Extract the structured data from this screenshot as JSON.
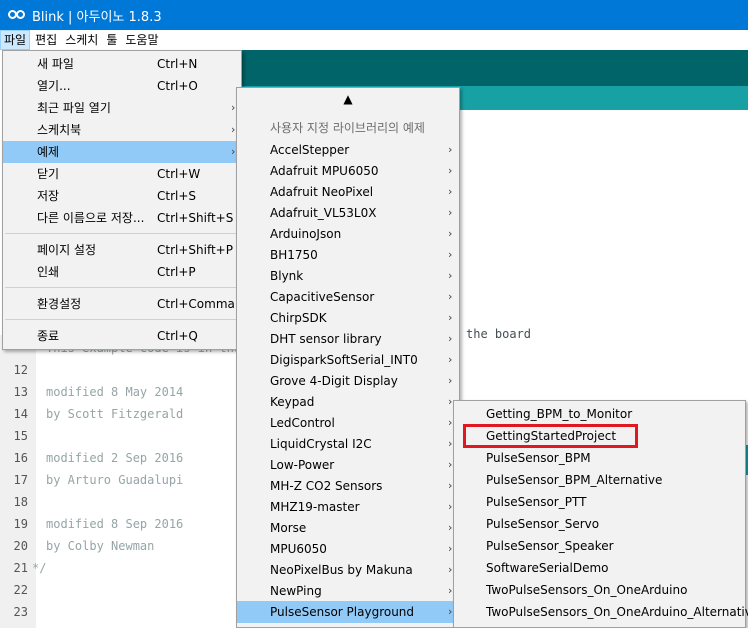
{
  "window": {
    "title": "Blink | 아두이노 1.8.3"
  },
  "menubar": {
    "items": [
      "파일",
      "편집",
      "스케치",
      "툴",
      "도움말"
    ]
  },
  "editor": {
    "line_numbers": [
      "12",
      "13",
      "14",
      "15",
      "16",
      "17",
      "18",
      "19",
      "20",
      "21",
      "22",
      "23"
    ],
    "partial_line": "This example code is in the",
    "board_text": "the board",
    "lines": [
      "",
      "modified 8 May 2014",
      "by Scott Fitzgerald",
      "",
      "modified 2 Sep 2016",
      "by Arturo Guadalupi",
      "",
      "modified 8 Sep 2016",
      "by Colby Newman",
      "*/",
      "",
      ""
    ]
  },
  "file_menu": {
    "items": [
      {
        "label": "새 파일",
        "shortcut": "Ctrl+N"
      },
      {
        "label": "열기...",
        "shortcut": "Ctrl+O"
      },
      {
        "label": "최근 파일 열기",
        "shortcut": ""
      },
      {
        "label": "스케치북",
        "shortcut": ""
      },
      {
        "label": "예제",
        "shortcut": ""
      },
      {
        "label": "닫기",
        "shortcut": "Ctrl+W"
      },
      {
        "label": "저장",
        "shortcut": "Ctrl+S"
      },
      {
        "label": "다른 이름으로 저장...",
        "shortcut": "Ctrl+Shift+S"
      },
      {
        "label": "페이지 설정",
        "shortcut": "Ctrl+Shift+P"
      },
      {
        "label": "인쇄",
        "shortcut": "Ctrl+P"
      },
      {
        "label": "환경설정",
        "shortcut": "Ctrl+Comma"
      },
      {
        "label": "종료",
        "shortcut": "Ctrl+Q"
      }
    ]
  },
  "examples_menu": {
    "scroll_up": "▲",
    "section_header": "사용자 지정 라이브러리의 예제",
    "items": [
      "AccelStepper",
      "Adafruit MPU6050",
      "Adafruit NeoPixel",
      "Adafruit_VL53L0X",
      "ArduinoJson",
      "BH1750",
      "Blynk",
      "CapacitiveSensor",
      "ChirpSDK",
      "DHT sensor library",
      "DigisparkSoftSerial_INT0",
      "Grove 4-Digit Display",
      "Keypad",
      "LedControl",
      "LiquidCrystal I2C",
      "Low-Power",
      "MH-Z CO2 Sensors",
      "MHZ19-master",
      "Morse",
      "MPU6050",
      "NeoPixelBus by Makuna",
      "NewPing",
      "PulseSensor Playground"
    ]
  },
  "pulse_menu": {
    "items": [
      "Getting_BPM_to_Monitor",
      "GettingStartedProject",
      "PulseSensor_BPM",
      "PulseSensor_BPM_Alternative",
      "PulseSensor_PTT",
      "PulseSensor_Servo",
      "PulseSensor_Speaker",
      "SoftwareSerialDemo",
      "TwoPulseSensors_On_OneArduino",
      "TwoPulseSensors_On_OneArduino_Alternative"
    ]
  },
  "icons": {
    "submenu": "›",
    "app_logo": "arduino-logo-icon"
  },
  "colors": {
    "titlebar": "#0078d7",
    "highlight": "#91c9f7",
    "teal_dark": "#006468",
    "teal": "#17a1a5",
    "annotation": "#e0181f"
  }
}
